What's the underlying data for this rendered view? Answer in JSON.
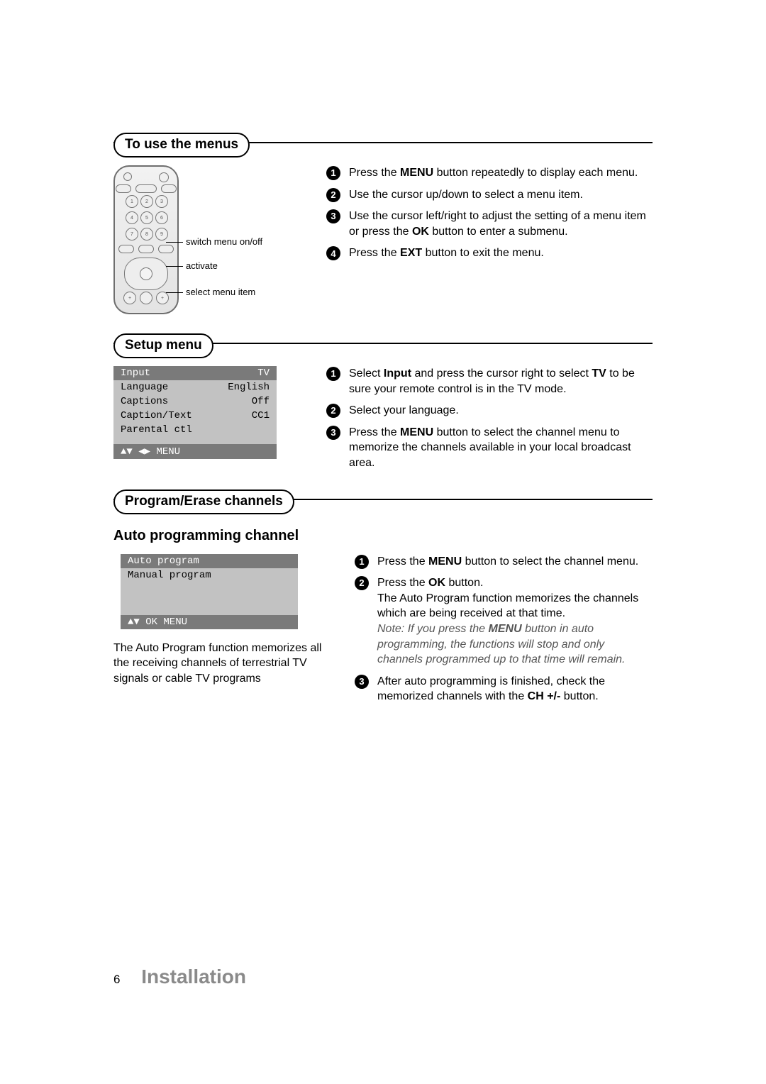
{
  "sections": {
    "use_menus": {
      "title": "To use the menus",
      "remote_callouts": {
        "c1": "switch menu on/off",
        "c2": "activate",
        "c3": "select menu item"
      },
      "steps": [
        {
          "n": "1",
          "pre": "Press the ",
          "b1": "MENU",
          "post": " button repeatedly to display each menu."
        },
        {
          "n": "2",
          "text": "Use the cursor up/down to select a menu item."
        },
        {
          "n": "3",
          "pre": "Use the cursor left/right to adjust the setting of a menu item or press the ",
          "b1": "OK",
          "post": " button to enter a submenu."
        },
        {
          "n": "4",
          "pre": "Press the ",
          "b1": "EXT",
          "post": " button to exit the menu."
        }
      ]
    },
    "setup_menu": {
      "title": "Setup menu",
      "osd": {
        "rows": [
          {
            "label": "Input",
            "value": "TV",
            "sel": true
          },
          {
            "label": "Language",
            "value": "English"
          },
          {
            "label": "Captions",
            "value": "Off"
          },
          {
            "label": "Caption/Text",
            "value": "CC1"
          },
          {
            "label": "Parental ctl",
            "value": ""
          }
        ],
        "footer": "▲▼ ◀▶  MENU"
      },
      "steps": [
        {
          "n": "1",
          "pre": "Select ",
          "b1": "Input",
          "mid": " and press the cursor right to select ",
          "b2": "TV",
          "post": " to be sure your remote control is in the TV mode."
        },
        {
          "n": "2",
          "text": "Select your language."
        },
        {
          "n": "3",
          "pre": "Press the ",
          "b1": "MENU",
          "post": " button to select the channel menu to memorize the channels available in your local broadcast area."
        }
      ]
    },
    "program_erase": {
      "title": "Program/Erase channels",
      "subhead": "Auto programming channel",
      "osd": {
        "rows": [
          {
            "label": "Auto program",
            "value": "",
            "sel": true
          },
          {
            "label": "Manual program",
            "value": ""
          }
        ],
        "footer": "▲▼ OK MENU"
      },
      "left_text": "The Auto Program function memorizes all the receiving channels of terrestrial TV signals or cable TV programs",
      "steps": [
        {
          "n": "1",
          "pre": "Press the ",
          "b1": "MENU",
          "post": " button to select the channel menu."
        },
        {
          "n": "2",
          "pre": "Press the ",
          "b1": "OK",
          "post1": " button.",
          "line2": "The Auto Program function memorizes the channels which are being received at that time.",
          "note_pre": "Note: If you press the ",
          "note_b": "MENU",
          "note_post": " button in auto programming, the functions will stop and only channels programmed up to that time will remain."
        },
        {
          "n": "3",
          "pre": "After auto programming is finished, check the memorized channels with the ",
          "b1": "CH +/-",
          "post": " button."
        }
      ]
    }
  },
  "footer": {
    "page_number": "6",
    "section_name": "Installation"
  }
}
